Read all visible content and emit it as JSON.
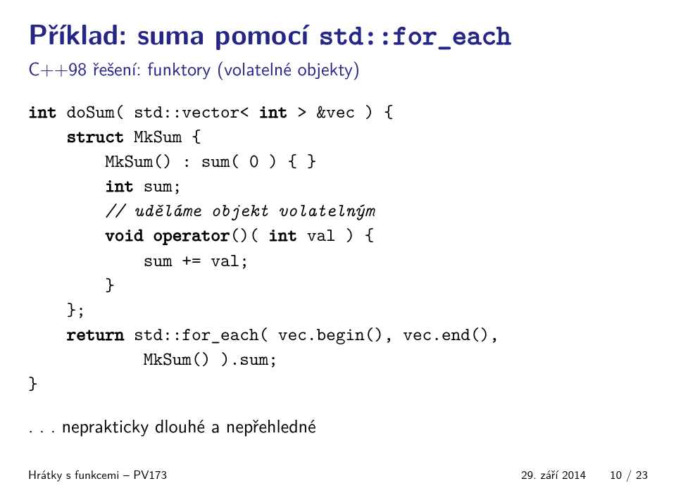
{
  "title": {
    "prefix": "Příklad: suma pomocí ",
    "code": "std::for_each"
  },
  "subtitle": "C++98 řešení: funktory (volatelné objekty)",
  "code": {
    "l1a": "int",
    "l1b": " doSum( std::vector< ",
    "l1c": "int",
    "l1d": " > &vec ) {",
    "l2a": "    ",
    "l2b": "struct",
    "l2c": " MkSum {",
    "l3": "        MkSum() : sum( 0 ) { }",
    "l4a": "        ",
    "l4b": "int",
    "l4c": " sum;",
    "l5a": "        ",
    "l5b": "// uděláme objekt volatelným",
    "l6a": "        ",
    "l6b": "void",
    "l6c": " ",
    "l6d": "operator",
    "l6e": "()( ",
    "l6f": "int",
    "l6g": " val ) {",
    "l7": "            sum += val;",
    "l8": "        }",
    "l9": "    };",
    "l10a": "    ",
    "l10b": "return",
    "l10c": " std::for_each( vec.begin(), vec.end(),",
    "l11": "            MkSum() ).sum;",
    "l12": "}"
  },
  "note": ". . . neprakticky dlouhé a nepřehledné",
  "footer": {
    "left": "Hrátky s funkcemi – PV173",
    "date": "29. září 2014",
    "page_current": "10",
    "page_sep": " / ",
    "page_total": "23"
  }
}
